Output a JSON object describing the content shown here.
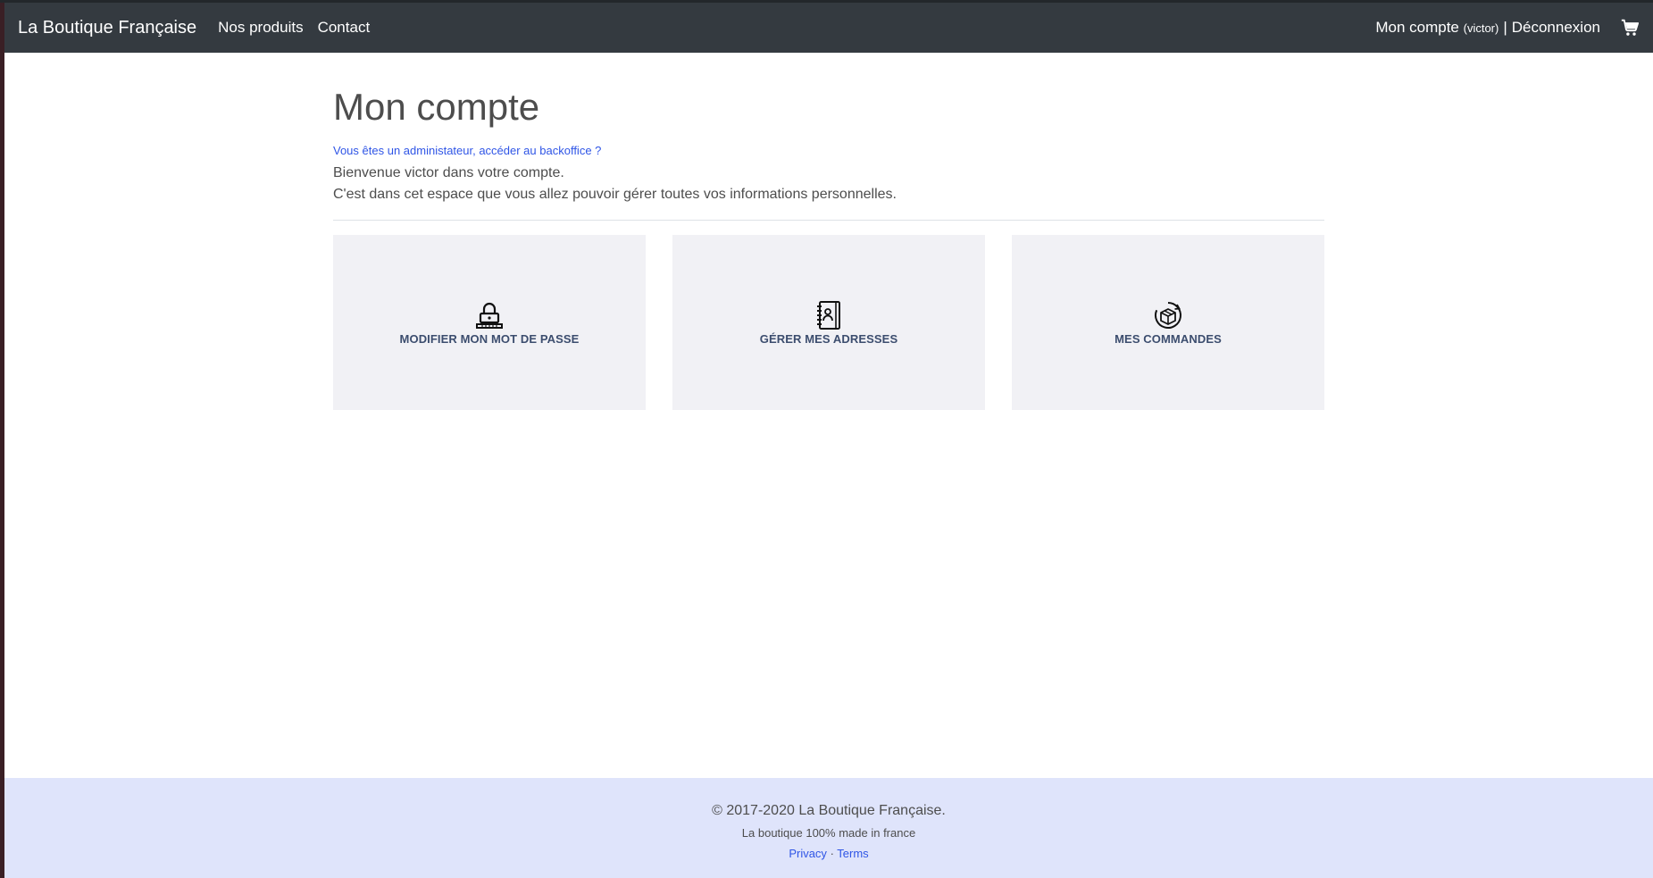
{
  "navbar": {
    "brand": "La Boutique Française",
    "links": [
      {
        "label": "Nos produits"
      },
      {
        "label": "Contact"
      }
    ],
    "account_label": "Mon compte",
    "account_user": "(victor)",
    "separator": "|",
    "logout_label": "Déconnexion",
    "cart_icon": "cart-icon"
  },
  "main": {
    "title": "Mon compte",
    "admin_link": "Vous êtes un administateur, accéder au backoffice ?",
    "welcome": "Bienvenue victor dans votre compte.",
    "info": "C'est dans cet espace que vous allez pouvoir gérer toutes vos informations personnelles.",
    "cards": [
      {
        "icon": "lock-icon",
        "label": "MODIFIER MON MOT DE PASSE"
      },
      {
        "icon": "address-book-icon",
        "label": "GÉRER MES ADRESSES"
      },
      {
        "icon": "box-icon",
        "label": "MES COMMANDES"
      }
    ]
  },
  "footer": {
    "copyright": "© 2017-2020 La Boutique Française.",
    "tagline": "La boutique 100% made in france",
    "privacy": "Privacy",
    "dot": "·",
    "terms": "Terms"
  },
  "colors": {
    "navbar_bg": "#343a40",
    "footer_bg": "#dfe4fb",
    "card_bg": "#f1f1f5",
    "link": "#2f55e6",
    "card_label": "#3c4d6e"
  }
}
